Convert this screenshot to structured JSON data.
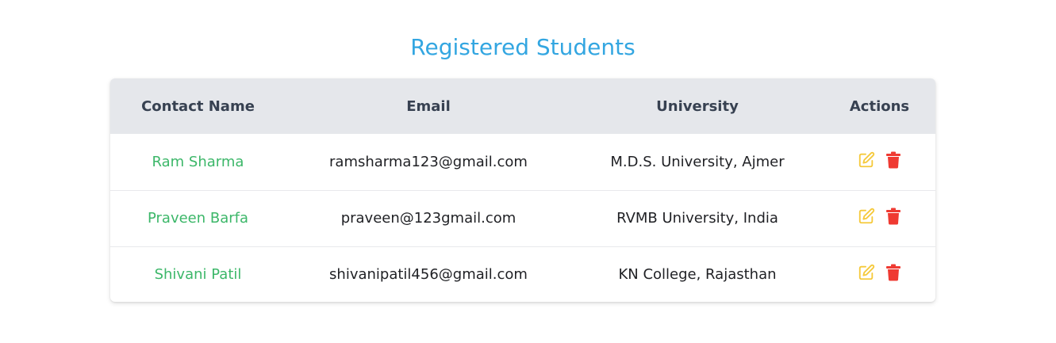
{
  "page": {
    "title": "Registered Students"
  },
  "table": {
    "headers": [
      "Contact Name",
      "Email",
      "University",
      "Actions"
    ],
    "rows": [
      {
        "name": "Ram Sharma",
        "email": "ramsharma123@gmail.com",
        "university": "M.D.S. University, Ajmer"
      },
      {
        "name": "Praveen Barfa",
        "email": "praveen@123gmail.com",
        "university": "RVMB University, India"
      },
      {
        "name": "Shivani Patil",
        "email": "shivanipatil456@gmail.com",
        "university": "KN College, Rajasthan"
      }
    ],
    "row_actions": [
      {
        "icon": "edit-icon"
      },
      {
        "icon": "trash-icon"
      }
    ]
  },
  "colors": {
    "title": "#33a6e1",
    "header_bg": "#e5e7eb",
    "header_text": "#374151",
    "name_text": "#3cb769",
    "edit_icon": "#f5c93b",
    "delete_icon": "#ef3a32"
  }
}
